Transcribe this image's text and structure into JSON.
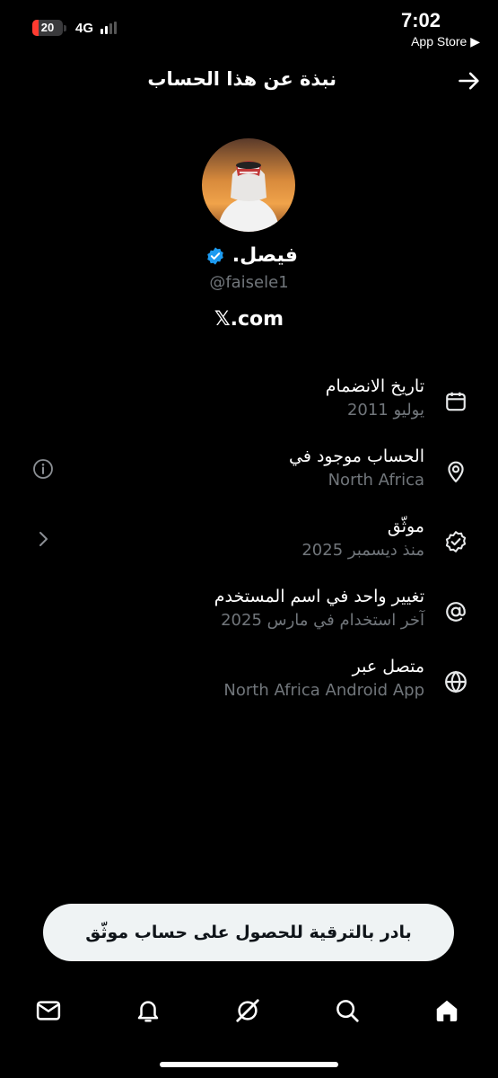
{
  "status_bar": {
    "battery": "20",
    "network": "4G",
    "time": "7:02",
    "back_to_app": "App Store ▶"
  },
  "header": {
    "title": "نبذة عن هذا الحساب",
    "back_icon": "arrow-right-icon"
  },
  "profile": {
    "name": "فيصل.",
    "verified_icon": "verified-badge-icon",
    "handle": "@faisele1",
    "site": "𝕏.com"
  },
  "info": [
    {
      "icon": "calendar-icon",
      "title": "تاريخ الانضمام",
      "subtitle": "يوليو 2011"
    },
    {
      "icon": "location-pin-icon",
      "title": "الحساب موجود في",
      "subtitle": "North Africa"
    },
    {
      "icon": "verified-outline-icon",
      "title": "موثّق",
      "subtitle": "منذ ديسمبر 2025"
    },
    {
      "icon": "at-sign-icon",
      "title": "تغيير واحد في اسم المستخدم",
      "subtitle": "آخر استخدام في مارس 2025"
    },
    {
      "icon": "globe-icon",
      "title": "متصل عبر",
      "subtitle": "North Africa Android App"
    }
  ],
  "upgrade_button": "بادر بالترقية للحصول على حساب موثّق",
  "tabs": [
    "mail-icon",
    "bell-icon",
    "grok-icon",
    "search-icon",
    "home-icon"
  ],
  "colors": {
    "background": "#000000",
    "muted": "#71767b",
    "verified": "#1d9bf0",
    "button_bg": "#eff3f4"
  }
}
